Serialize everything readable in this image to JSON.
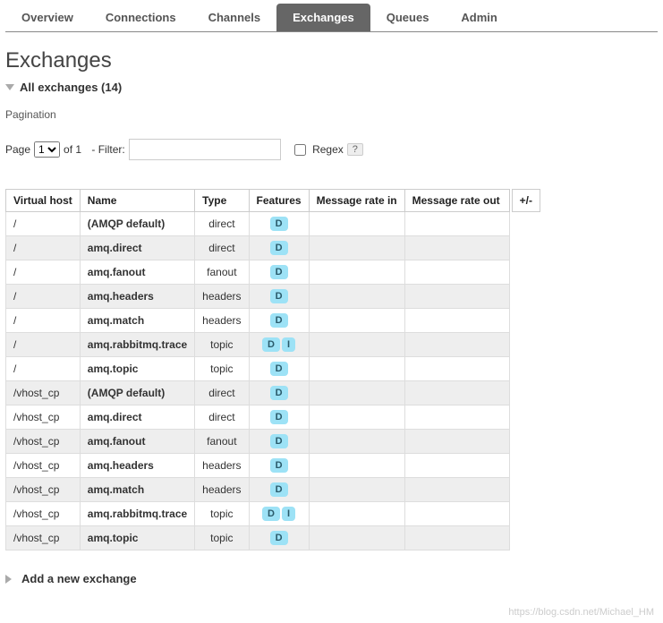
{
  "tabs": [
    {
      "label": "Overview",
      "active": false
    },
    {
      "label": "Connections",
      "active": false
    },
    {
      "label": "Channels",
      "active": false
    },
    {
      "label": "Exchanges",
      "active": true
    },
    {
      "label": "Queues",
      "active": false
    },
    {
      "label": "Admin",
      "active": false
    }
  ],
  "page_title": "Exchanges",
  "section_all": "All exchanges (14)",
  "pagination": {
    "title": "Pagination",
    "page_label": "Page",
    "page_value": "1",
    "of_label": "of 1",
    "filter_label": "- Filter:",
    "filter_value": "",
    "regex_label": "Regex",
    "regex_checked": false,
    "help": "?"
  },
  "columns": {
    "vhost": "Virtual host",
    "name": "Name",
    "type": "Type",
    "features": "Features",
    "rate_in": "Message rate in",
    "rate_out": "Message rate out",
    "plus_minus": "+/-"
  },
  "rows": [
    {
      "vhost": "/",
      "name": "(AMQP default)",
      "type": "direct",
      "features": [
        "D"
      ],
      "rate_in": "",
      "rate_out": ""
    },
    {
      "vhost": "/",
      "name": "amq.direct",
      "type": "direct",
      "features": [
        "D"
      ],
      "rate_in": "",
      "rate_out": ""
    },
    {
      "vhost": "/",
      "name": "amq.fanout",
      "type": "fanout",
      "features": [
        "D"
      ],
      "rate_in": "",
      "rate_out": ""
    },
    {
      "vhost": "/",
      "name": "amq.headers",
      "type": "headers",
      "features": [
        "D"
      ],
      "rate_in": "",
      "rate_out": ""
    },
    {
      "vhost": "/",
      "name": "amq.match",
      "type": "headers",
      "features": [
        "D"
      ],
      "rate_in": "",
      "rate_out": ""
    },
    {
      "vhost": "/",
      "name": "amq.rabbitmq.trace",
      "type": "topic",
      "features": [
        "D",
        "I"
      ],
      "rate_in": "",
      "rate_out": ""
    },
    {
      "vhost": "/",
      "name": "amq.topic",
      "type": "topic",
      "features": [
        "D"
      ],
      "rate_in": "",
      "rate_out": ""
    },
    {
      "vhost": "/vhost_cp",
      "name": "(AMQP default)",
      "type": "direct",
      "features": [
        "D"
      ],
      "rate_in": "",
      "rate_out": ""
    },
    {
      "vhost": "/vhost_cp",
      "name": "amq.direct",
      "type": "direct",
      "features": [
        "D"
      ],
      "rate_in": "",
      "rate_out": ""
    },
    {
      "vhost": "/vhost_cp",
      "name": "amq.fanout",
      "type": "fanout",
      "features": [
        "D"
      ],
      "rate_in": "",
      "rate_out": ""
    },
    {
      "vhost": "/vhost_cp",
      "name": "amq.headers",
      "type": "headers",
      "features": [
        "D"
      ],
      "rate_in": "",
      "rate_out": ""
    },
    {
      "vhost": "/vhost_cp",
      "name": "amq.match",
      "type": "headers",
      "features": [
        "D"
      ],
      "rate_in": "",
      "rate_out": ""
    },
    {
      "vhost": "/vhost_cp",
      "name": "amq.rabbitmq.trace",
      "type": "topic",
      "features": [
        "D",
        "I"
      ],
      "rate_in": "",
      "rate_out": ""
    },
    {
      "vhost": "/vhost_cp",
      "name": "amq.topic",
      "type": "topic",
      "features": [
        "D"
      ],
      "rate_in": "",
      "rate_out": ""
    }
  ],
  "add_exchange": "Add a new exchange",
  "watermark": "https://blog.csdn.net/Michael_HM"
}
